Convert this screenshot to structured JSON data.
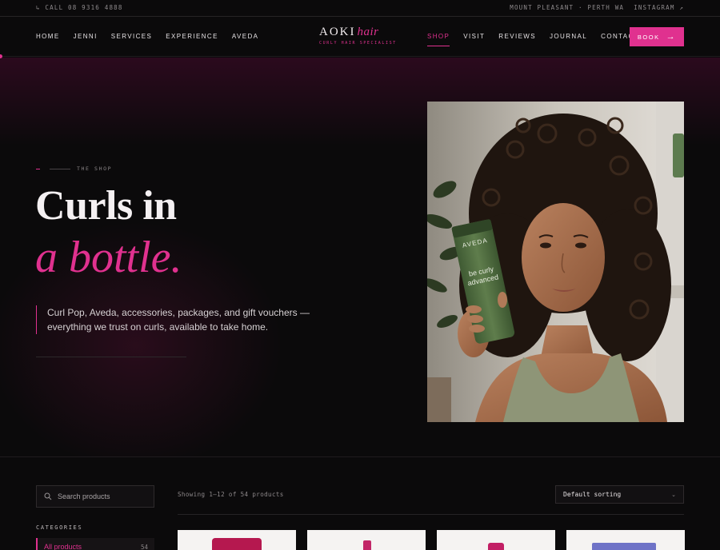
{
  "topbar": {
    "phone": "↳ CALL 08 9316 4888",
    "location": "MOUNT PLEASANT · PERTH WA",
    "instagram": "INSTAGRAM ↗"
  },
  "logo": {
    "name": "AOKI",
    "accent": "hair",
    "tagline": "CURLY HAIR SPECIALIST"
  },
  "nav_left": [
    "HOME",
    "JENNI",
    "SERVICES",
    "EXPERIENCE",
    "AVEDA"
  ],
  "nav_right": [
    "SHOP",
    "VISIT",
    "REVIEWS",
    "JOURNAL",
    "CONTACT"
  ],
  "active_nav": "SHOP",
  "book_button": {
    "label": "BOOK",
    "icon": "arrow-right-icon"
  },
  "hero": {
    "eyebrow": "THE SHOP",
    "title_line1": "Curls in",
    "title_line2": "a bottle.",
    "lede": "Curl Pop, Aveda, accessories, packages, and gift vouchers — everything we trust on curls, available to take home.",
    "photo_tube_text": [
      "AVEDA",
      "be curly",
      "advanced"
    ]
  },
  "shop": {
    "search_placeholder": "Search products",
    "categories_title": "CATEGORIES",
    "categories": [
      {
        "name": "All products",
        "count": "54"
      }
    ],
    "showing": "Showing 1–12 of 54 products",
    "sorting": "Default sorting"
  },
  "colors": {
    "accent": "#e0318f",
    "background": "#0b0a0b",
    "text": "#d9d4d6"
  }
}
